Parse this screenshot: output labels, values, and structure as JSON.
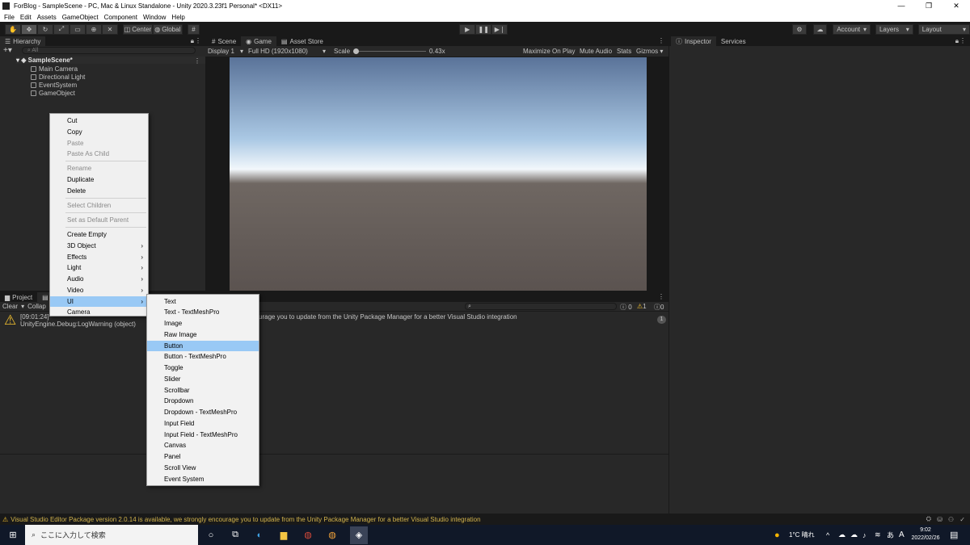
{
  "window": {
    "title": "ForBlog - SampleScene - PC, Mac & Linux Standalone - Unity 2020.3.23f1 Personal* <DX11>",
    "minimize": "—",
    "maximize": "❐",
    "close": "✕"
  },
  "menu": [
    "File",
    "Edit",
    "Assets",
    "GameObject",
    "Component",
    "Window",
    "Help"
  ],
  "toolbar": {
    "center": "Center",
    "global": "Global",
    "account": "Account",
    "layers": "Layers",
    "layout": "Layout"
  },
  "hierarchy": {
    "tab": "Hierarchy",
    "search_placeholder": "All",
    "scene": "SampleScene*",
    "items": [
      "Main Camera",
      "Directional Light",
      "EventSystem",
      "GameObject"
    ]
  },
  "game": {
    "tabs": [
      "Scene",
      "Game",
      "Asset Store"
    ],
    "display": "Display 1",
    "resolution": "Full HD (1920x1080)",
    "scale_label": "Scale",
    "scale_value": "0.43x",
    "maximize": "Maximize On Play",
    "mute": "Mute Audio",
    "stats": "Stats",
    "gizmos": "Gizmos",
    "colors": {
      "sky_top": "#5a7399",
      "sky_mid": "#aac8e4",
      "horizon": "#f2f7fb",
      "ground_top": "#6f6762",
      "ground_bottom": "#5b5350"
    }
  },
  "inspector": {
    "tabs": [
      "Inspector",
      "Services"
    ]
  },
  "bottom": {
    "tabs": [
      "Project",
      "Console"
    ],
    "clear": "Clear",
    "collapse": "Collap",
    "counts": {
      "info": "0",
      "warn": "1",
      "error": "0"
    },
    "log_line1": "[09:01:24]",
    "log_line1_tail": "urage you to update from the Unity Package Manager for a better Visual Studio integration",
    "log_line2": "UnityEngine.Debug:LogWarning (object)",
    "log_count": "1"
  },
  "context_menu": {
    "items": [
      {
        "label": "Cut",
        "enabled": true
      },
      {
        "label": "Copy",
        "enabled": true
      },
      {
        "label": "Paste",
        "enabled": false
      },
      {
        "label": "Paste As Child",
        "enabled": false
      },
      {
        "label": "Rename",
        "enabled": false
      },
      {
        "label": "Duplicate",
        "enabled": true
      },
      {
        "label": "Delete",
        "enabled": true
      },
      {
        "label": "Select Children",
        "enabled": false
      },
      {
        "label": "Set as Default Parent",
        "enabled": false
      },
      {
        "label": "Create Empty",
        "enabled": true
      },
      {
        "label": "3D Object",
        "enabled": true,
        "submenu": true
      },
      {
        "label": "Effects",
        "enabled": true,
        "submenu": true
      },
      {
        "label": "Light",
        "enabled": true,
        "submenu": true
      },
      {
        "label": "Audio",
        "enabled": true,
        "submenu": true
      },
      {
        "label": "Video",
        "enabled": true,
        "submenu": true
      },
      {
        "label": "UI",
        "enabled": true,
        "submenu": true,
        "highlighted": true
      },
      {
        "label": "Camera",
        "enabled": true
      }
    ]
  },
  "ui_submenu": {
    "items": [
      "Text",
      "Text - TextMeshPro",
      "Image",
      "Raw Image",
      "Button",
      "Button - TextMeshPro",
      "Toggle",
      "Slider",
      "Scrollbar",
      "Dropdown",
      "Dropdown - TextMeshPro",
      "Input Field",
      "Input Field - TextMeshPro",
      "Canvas",
      "Panel",
      "Scroll View",
      "Event System"
    ],
    "highlighted": "Button"
  },
  "status": {
    "message": "Visual Studio Editor Package version 2.0.14 is available, we strongly encourage you to update from the Unity Package Manager for a better Visual Studio integration"
  },
  "taskbar": {
    "search_placeholder": "ここに入力して検索",
    "weather": "1°C 晴れ",
    "ime": "A",
    "time": "9:02",
    "date": "2022/02/26"
  }
}
